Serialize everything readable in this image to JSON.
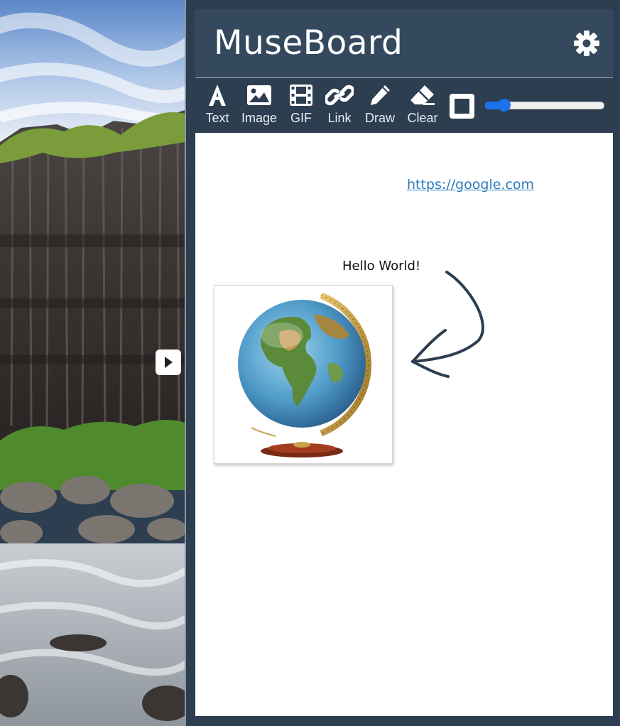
{
  "app": {
    "title": "MuseBoard"
  },
  "toolbar": {
    "tools": [
      {
        "label": "Text",
        "icon": "text-icon"
      },
      {
        "label": "Image",
        "icon": "image-icon"
      },
      {
        "label": "GIF",
        "icon": "film-icon"
      },
      {
        "label": "Link",
        "icon": "link-icon"
      },
      {
        "label": "Draw",
        "icon": "pencil-icon"
      },
      {
        "label": "Clear",
        "icon": "eraser-icon"
      }
    ],
    "shape_toggle_icon": "square-outline-icon",
    "brush_size": {
      "fraction": 0.16
    }
  },
  "board": {
    "link_text": "https://google.com",
    "text_note": "Hello World!",
    "image_icon": "globe-icon",
    "drawing_icon": "hand-drawn-arrow-icon"
  },
  "colors": {
    "panel_bg": "#2c3e50",
    "header_bg": "#34495e",
    "accent": "#1a73e8",
    "link": "#2b7bbd",
    "ink": "#2c3e50"
  }
}
